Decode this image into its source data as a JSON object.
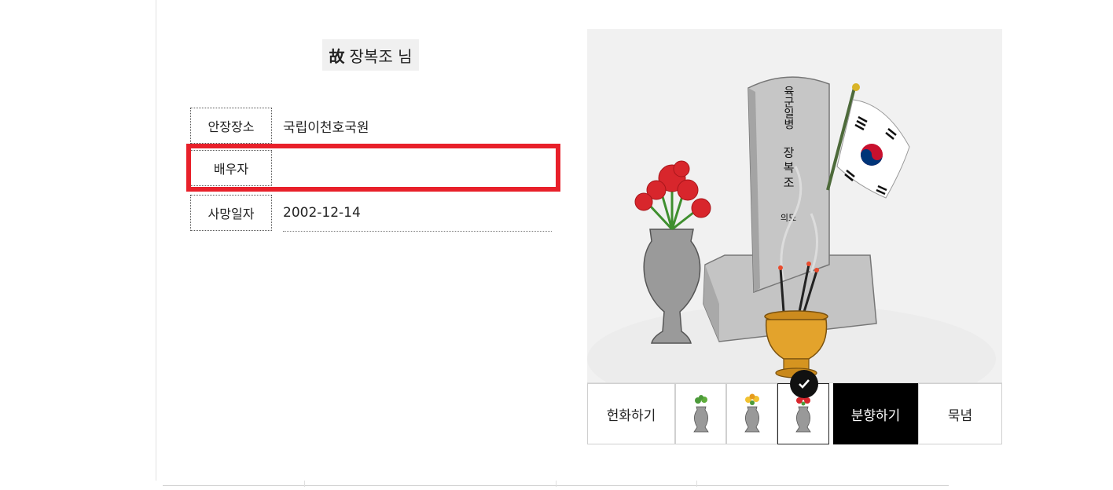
{
  "profile": {
    "prefix": "故",
    "name": "장복조 님"
  },
  "info": {
    "rows": [
      {
        "label": "안장장소",
        "value": "국립이천호국원"
      },
      {
        "label": "배우자",
        "value": ""
      },
      {
        "label": "사망일자",
        "value": "2002-12-14"
      }
    ]
  },
  "memorial": {
    "inscription_rank": "육군일병",
    "inscription_name": "장복조",
    "inscription_suffix": "의묘",
    "flag": "korean-flag",
    "colors": {
      "highlight": "#e8202a",
      "flower_red": "#d8262c",
      "brazier_gold": "#e3a32c",
      "stone_gray": "#b9b9b9"
    }
  },
  "actions": {
    "offer_flower": "헌화하기",
    "flower_options": [
      "green-flower-vase-icon",
      "yellow-flower-vase-icon",
      "red-flower-vase-icon"
    ],
    "selected_option": "red-flower-vase-icon",
    "incense": "분향하기",
    "silent_tribute": "묵념"
  }
}
